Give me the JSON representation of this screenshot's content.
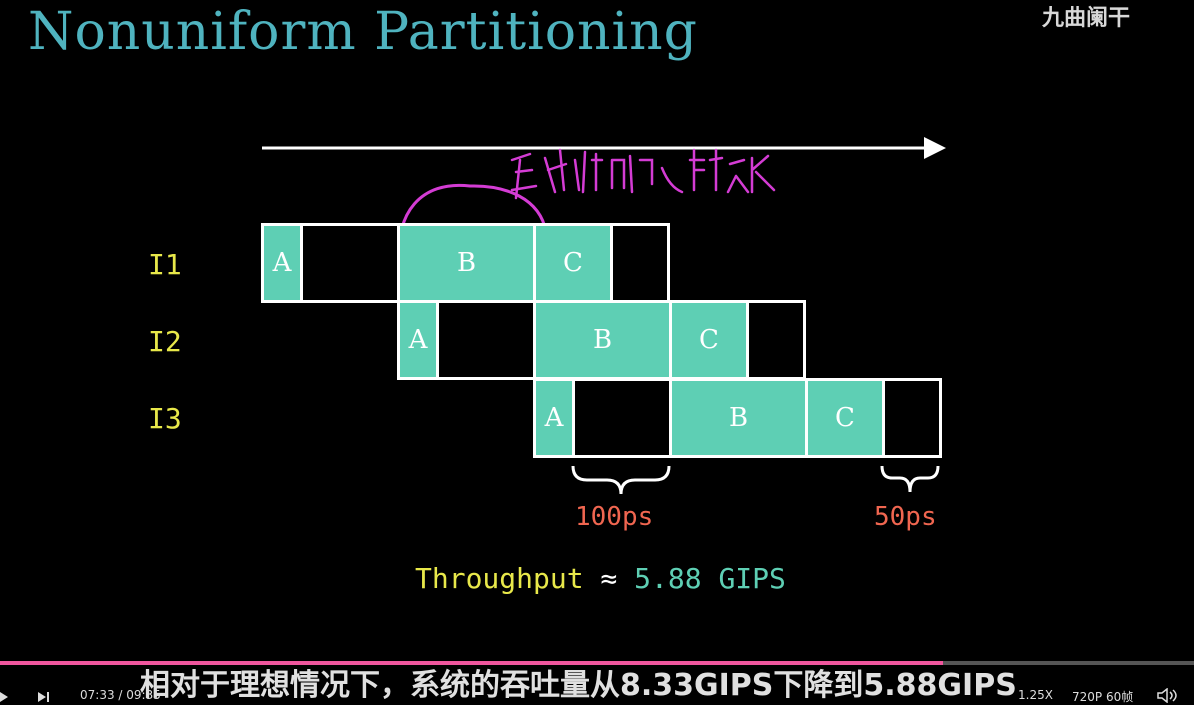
{
  "title": "Nonuniform Partitioning",
  "watermark": "九曲阑干",
  "rows": [
    {
      "label": "I1",
      "cells": [
        {
          "text": "A",
          "fill": true
        },
        {
          "text": "",
          "fill": false
        },
        {
          "text": "B",
          "fill": true
        },
        {
          "text": "C",
          "fill": true
        },
        {
          "text": "",
          "fill": false
        }
      ]
    },
    {
      "label": "I2",
      "cells": [
        {
          "text": "A",
          "fill": true
        },
        {
          "text": "",
          "fill": false
        },
        {
          "text": "B",
          "fill": true
        },
        {
          "text": "C",
          "fill": true
        },
        {
          "text": "",
          "fill": false
        }
      ]
    },
    {
      "label": "I3",
      "cells": [
        {
          "text": "A",
          "fill": true
        },
        {
          "text": "",
          "fill": false
        },
        {
          "text": "B",
          "fill": true
        },
        {
          "text": "C",
          "fill": true
        },
        {
          "text": "",
          "fill": false
        }
      ]
    }
  ],
  "annotations": {
    "brace1": "100ps",
    "brace2": "50ps"
  },
  "throughput": {
    "label": "Throughput",
    "approx": "≈",
    "value": "5.88 GIPS"
  },
  "subtitle": "相对于理想情况下，系统的吞吐量从8.33GIPS下降到5.88GIPS",
  "player": {
    "time": "07:33 / 09:35",
    "speed": "1.25X",
    "quality": "720P 60帧",
    "progress": 0.79
  },
  "colors": {
    "fill": "#5ecfb4",
    "title": "#4fb3bf",
    "label": "#e8e84a",
    "ps": "#f06650",
    "progress": "#f0569e"
  }
}
